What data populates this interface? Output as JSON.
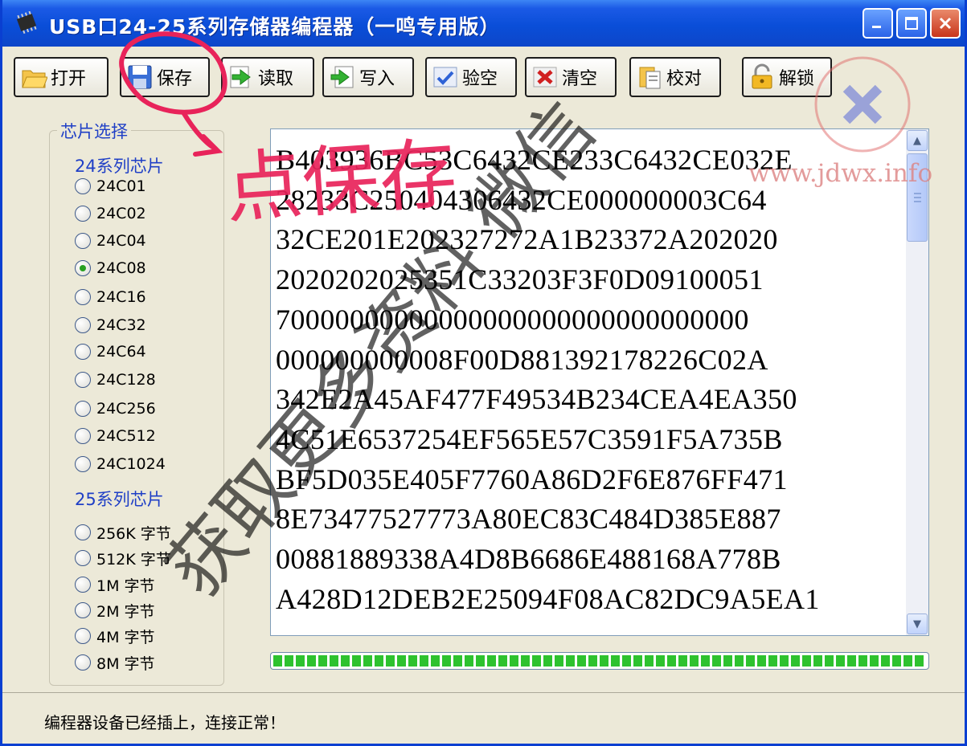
{
  "window": {
    "title": "USB口24-25系列存储器编程器（一鸣专用版）",
    "title_controls": [
      "minimize-icon",
      "maximize-icon",
      "close-icon"
    ],
    "colors": {
      "titlebar": "#0a4ed8",
      "face": "#ece9d8",
      "label_blue": "#1f3fc6",
      "progress": "#2ec22e"
    }
  },
  "toolbar": {
    "buttons": [
      {
        "label": "打开",
        "icon": "open-folder-icon"
      },
      {
        "label": "保存",
        "icon": "save-disk-icon"
      },
      {
        "label": "读取",
        "icon": "read-arrow-icon"
      },
      {
        "label": "写入",
        "icon": "write-arrow-icon"
      },
      {
        "label": "验空",
        "icon": "check-mark-icon"
      },
      {
        "label": "清空",
        "icon": "clear-x-icon"
      },
      {
        "label": "校对",
        "icon": "verify-clipboard-icon"
      },
      {
        "label": "解锁",
        "icon": "unlock-padlock-icon"
      }
    ]
  },
  "chip_select": {
    "title": "芯片选择",
    "series24_label": "24系列芯片",
    "series24": [
      "24C01",
      "24C02",
      "24C04",
      "24C08",
      "24C16",
      "24C32",
      "24C64",
      "24C128",
      "24C256",
      "24C512",
      "24C1024"
    ],
    "selected": "24C08",
    "series25_label": "25系列芯片",
    "series25": [
      "256K 字节",
      "512K 字节",
      "1M 字节",
      "2M 字节",
      "4M 字节",
      "8M 字节"
    ]
  },
  "hex_data": {
    "lines": [
      "B403936BC53C6432CE233C6432CE032E",
      "28233C250404306432CE000000003C64",
      "32CE201E202327272A1B23372A202020",
      "2020202025351C33203F3F0D09100051",
      "70000000000000000000000000000000",
      "000000000008F00D881392178226C02A",
      "342E2A45AF477F49534B234CEA4EA350",
      "4C51E6537254EF565E57C3591F5A735B",
      "BF5D035E405F7760A86D2F6E876FF471",
      "8E73477527773A80EC83C484D385E887",
      "00881889338A4D8B6686E488168A778B",
      "A428D12DEB2E25094F08AC82DC9A5EA1"
    ]
  },
  "progress": {
    "value": 1.0
  },
  "status": {
    "text": "编程器设备已经插上，连接正常！"
  },
  "overlay": {
    "handwriting_text": "点保存",
    "watermark_text": "获取更多资料 微信",
    "site_watermark": "www.jdwx.info"
  }
}
